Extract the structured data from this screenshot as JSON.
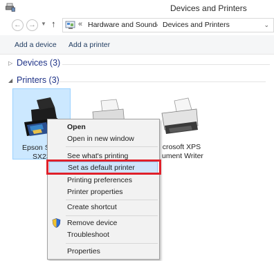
{
  "window": {
    "title": "Devices and Printers",
    "icon": "devices-printers-icon"
  },
  "navigation": {
    "back_icon": "arrow-left-icon",
    "forward_icon": "arrow-right-icon",
    "up_icon": "arrow-up-icon",
    "address": {
      "overflow": "«",
      "crumbs": [
        "Hardware and Sound",
        "Devices and Printers"
      ],
      "separator": "›"
    }
  },
  "toolbar": {
    "add_device": "Add a device",
    "add_printer": "Add a printer"
  },
  "groups": {
    "devices": {
      "label": "Devices (3)",
      "expanded": false
    },
    "printers": {
      "label": "Printers (3)",
      "expanded": true
    }
  },
  "printers": [
    {
      "label_line1": "Epson St",
      "label_line2": "SX23",
      "selected": true
    },
    {
      "label_line1": "",
      "label_line2": "",
      "selected": false
    },
    {
      "label_line1": "crosoft XPS",
      "label_line2": "ument Writer",
      "selected": false
    }
  ],
  "context_menu": {
    "items": {
      "open": "Open",
      "open_new_window": "Open in new window",
      "see_printing": "See what's printing",
      "set_default": "Set as default printer",
      "printing_prefs": "Printing preferences",
      "printer_props": "Printer properties",
      "create_shortcut": "Create shortcut",
      "remove_device": "Remove device",
      "troubleshoot": "Troubleshoot",
      "properties": "Properties"
    },
    "highlighted": "set_default",
    "highlight_color": "#e0202a"
  }
}
